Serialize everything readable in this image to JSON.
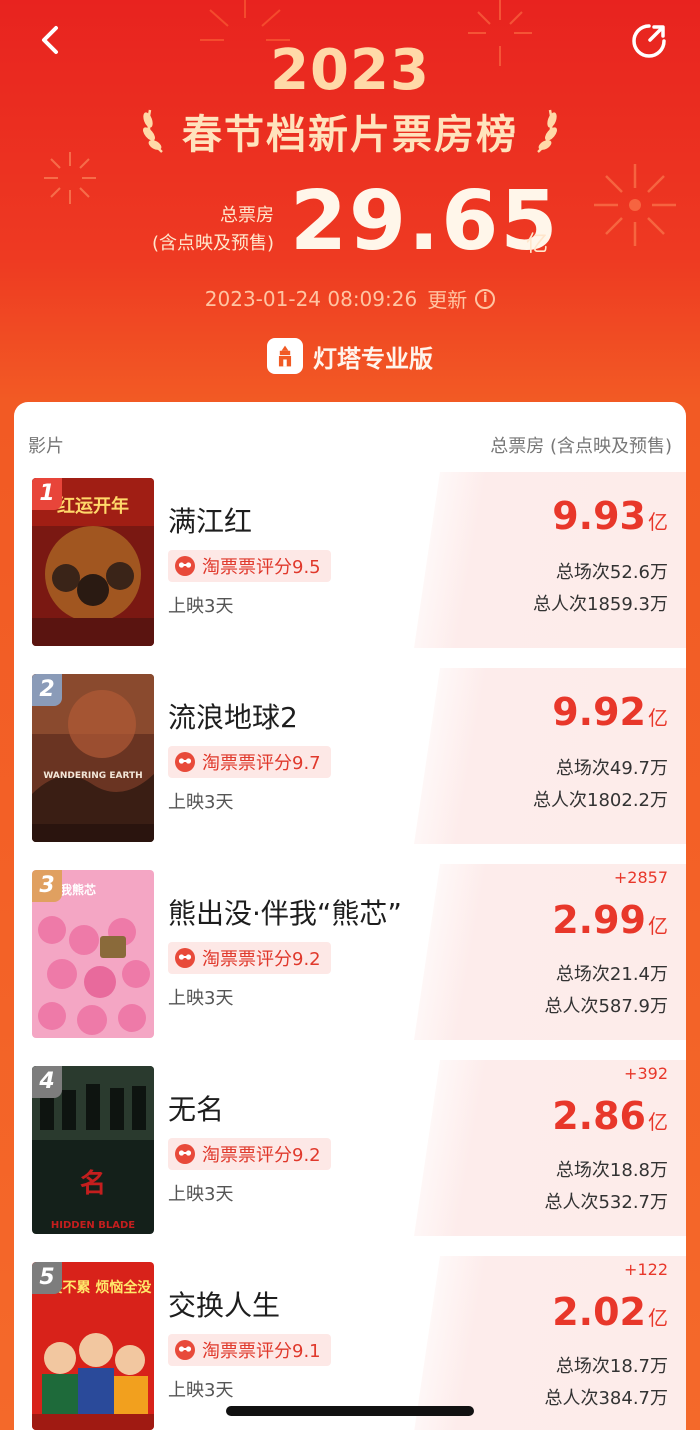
{
  "header": {
    "year": "2023",
    "title": "春节档新片票房榜",
    "total_label_line1": "总票房",
    "total_label_line2": "(含点映及预售)",
    "total_value": "29.65",
    "total_unit": "亿",
    "updated_time": "2023-01-24 08:09:26",
    "updated_suffix": "更新",
    "brand": "灯塔专业版"
  },
  "table": {
    "col_film": "影片",
    "col_box": "总票房 (含点映及预售)"
  },
  "colors": {
    "accent": "#e8372a",
    "rank1": "#e8453a",
    "rank2": "#8a9bb8",
    "rank3": "#e0a060",
    "rankN": "#7d7d7d"
  },
  "films": [
    {
      "rank": "1",
      "title": "满江红",
      "rating": "淘票票评分9.5",
      "days": "上映3天",
      "delta": "",
      "gross": "9.93",
      "unit": "亿",
      "sessions": "总场次52.6万",
      "admissions": "总人次1859.3万",
      "poster_text": "红运开年"
    },
    {
      "rank": "2",
      "title": "流浪地球2",
      "rating": "淘票票评分9.7",
      "days": "上映3天",
      "delta": "",
      "gross": "9.92",
      "unit": "亿",
      "sessions": "总场次49.7万",
      "admissions": "总人次1802.2万",
      "poster_text": "WANDERING EARTH"
    },
    {
      "rank": "3",
      "title": "熊出没·伴我“熊芯”",
      "rating": "淘票票评分9.2",
      "days": "上映3天",
      "delta": "+2857",
      "gross": "2.99",
      "unit": "亿",
      "sessions": "总场次21.4万",
      "admissions": "总人次587.9万",
      "poster_text": "伴我熊芯"
    },
    {
      "rank": "4",
      "title": "无名",
      "rating": "淘票票评分9.2",
      "days": "上映3天",
      "delta": "+392",
      "gross": "2.86",
      "unit": "亿",
      "sessions": "总场次18.8万",
      "admissions": "总人次532.7万",
      "poster_text": "HIDDEN BLADE"
    },
    {
      "rank": "5",
      "title": "交换人生",
      "rating": "淘票票评分9.1",
      "days": "上映3天",
      "delta": "+122",
      "gross": "2.02",
      "unit": "亿",
      "sessions": "总场次18.7万",
      "admissions": "总人次384.7万",
      "poster_text": "好笑不累 烦恼全没"
    }
  ]
}
